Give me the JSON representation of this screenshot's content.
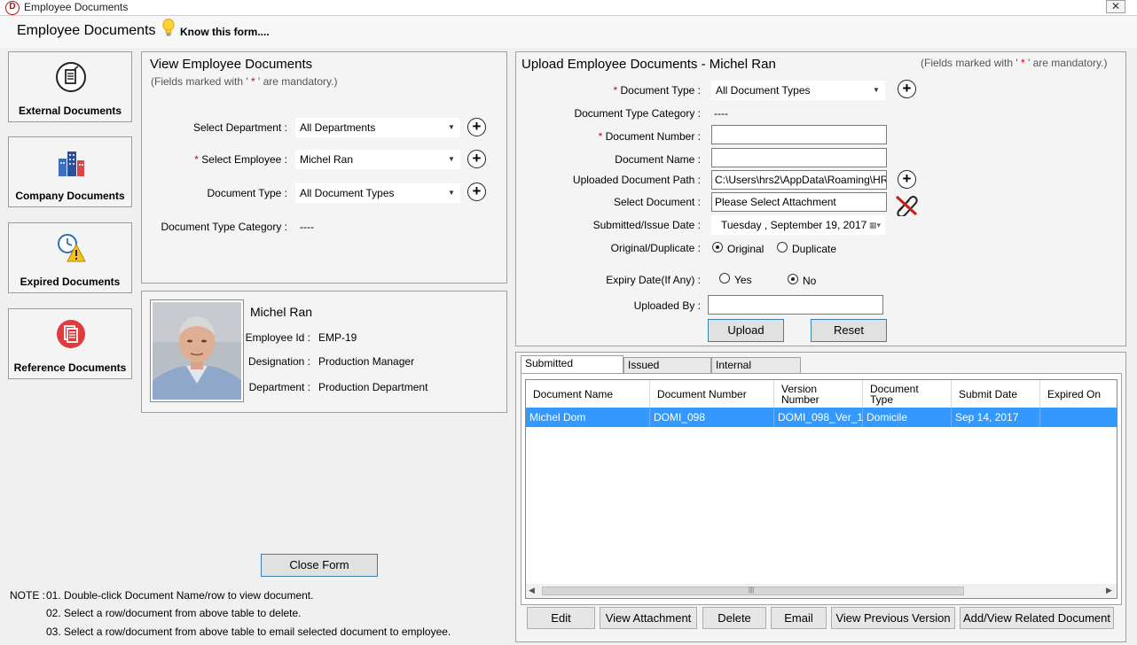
{
  "window": {
    "title": "Employee Documents",
    "close_glyph": "✕"
  },
  "header": {
    "title": "Employee Documents",
    "know_form": "Know this form....",
    "icon": "lightbulb-icon"
  },
  "nav": [
    {
      "label": "External Documents",
      "icon": "external-documents-icon"
    },
    {
      "label": "Company Documents",
      "icon": "company-buildings-icon"
    },
    {
      "label": "Expired Documents",
      "icon": "clock-warning-icon"
    },
    {
      "label": "Reference Documents",
      "icon": "reference-documents-icon"
    }
  ],
  "view": {
    "title": "View Employee Documents",
    "mandatory_prefix": "(Fields marked with ' ",
    "mandatory_star": "*",
    "mandatory_suffix": " ' are mandatory.)",
    "department_label": "Select Department :",
    "department_value": "All Departments",
    "employee_label": "Select Employee :",
    "employee_value": "Michel  Ran",
    "doctype_label": "Document Type :",
    "doctype_value": "All Document Types",
    "category_label": "Document Type Category :",
    "category_value": "----"
  },
  "profile": {
    "name": "Michel  Ran",
    "employee_id_label": "Employee Id :",
    "employee_id": "EMP-19",
    "designation_label": "Designation :",
    "designation": "Production Manager",
    "department_label": "Department :",
    "department": "Production Department"
  },
  "close_form": "Close Form",
  "notes": {
    "label": "NOTE :",
    "items": [
      "01. Double-click Document Name/row to view document.",
      "02. Select a row/document from above table to delete.",
      "03. Select a row/document from above table to email selected document to employee."
    ]
  },
  "upload": {
    "title": "Upload Employee Documents - Michel  Ran",
    "mandatory_prefix": "(Fields marked with ' ",
    "mandatory_star": "*",
    "mandatory_suffix": " ' are mandatory.)",
    "doctype_label": "Document Type :",
    "doctype_value": "All Document Types",
    "category_label": "Document Type Category :",
    "category_value": "----",
    "docnum_label": "Document Number :",
    "docnum_value": "",
    "docname_label": "Document Name :",
    "docname_value": "",
    "path_label": "Uploaded Document Path :",
    "path_value": "C:\\Users\\hrs2\\AppData\\Roaming\\HR",
    "select_label": "Select Document :",
    "select_value": "Please Select Attachment",
    "date_label": "Submitted/Issue Date :",
    "date_value": "Tuesday    , September 19, 2017",
    "orig_label": "Original/Duplicate :",
    "original": "Original",
    "duplicate": "Duplicate",
    "expiry_label": "Expiry Date(If Any) :",
    "yes": "Yes",
    "no": "No",
    "uploaded_by_label": "Uploaded By :",
    "uploaded_by_value": "",
    "upload_btn": "Upload",
    "reset_btn": "Reset"
  },
  "tabs": [
    "Submitted Documents",
    "Issued Documents",
    "Internal Documents"
  ],
  "table": {
    "columns": [
      "Document Name",
      "Document Number",
      "Version\nNumber",
      "Document\nType",
      "Submit Date",
      "Expired On"
    ],
    "rows": [
      [
        "Michel Dom",
        "DOMI_098",
        "DOMI_098_Ver_1",
        "Domicile",
        "Sep 14, 2017",
        ""
      ]
    ]
  },
  "actions": [
    "Edit",
    "View Attachment",
    "Delete",
    "Email",
    "View Previous Version",
    "Add/View Related Document"
  ],
  "colors": {
    "selection": "#3399ff",
    "required": "#dd0000",
    "accent_border": "#3c7fb1"
  }
}
